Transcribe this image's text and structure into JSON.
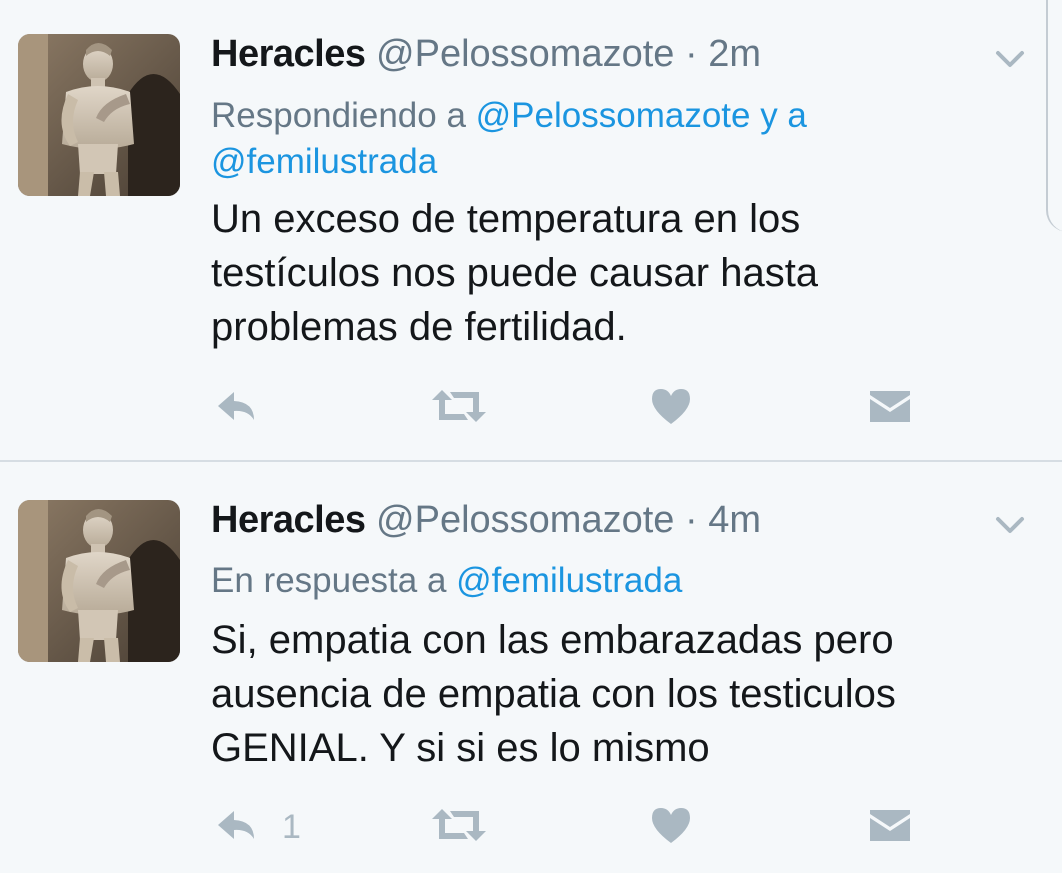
{
  "tweets": [
    {
      "author_name": "Heracles",
      "author_handle": "@Pelossomazote",
      "separator": "·",
      "time": "2m",
      "context_prefix": "Respondiendo a ",
      "context_mention_1": "@Pelossomazote",
      "context_joiner": " y a",
      "context_mention_2": "@femilustrada",
      "body_lines": [
        "Un exceso de temperatura en los",
        "testículos nos puede causar hasta",
        "problemas de fertilidad."
      ],
      "reply_count": ""
    },
    {
      "author_name": "Heracles",
      "author_handle": "@Pelossomazote",
      "separator": "·",
      "time": "4m",
      "context_prefix": "En respuesta a ",
      "context_mention_1": "@femilustrada",
      "body_lines": [
        "Si, empatia con las embarazadas pero",
        "ausencia de empatia con los testiculos",
        "GENIAL. Y si si es lo mismo"
      ],
      "reply_count": "1"
    }
  ],
  "icons": {
    "reply": "reply-icon",
    "retweet": "retweet-icon",
    "like": "heart-icon",
    "dm": "envelope-icon",
    "menu": "chevron-down-icon"
  },
  "colors": {
    "background": "#f5f8fa",
    "text": "#14171a",
    "secondary_text": "#657786",
    "mention": "#1b95e0",
    "action_icon": "#aab8c2"
  }
}
